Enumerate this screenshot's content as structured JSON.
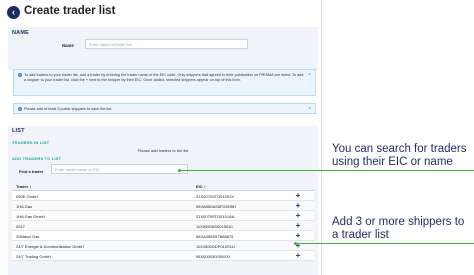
{
  "header": {
    "title": "Create trader list",
    "back_glyph": "‹"
  },
  "name_section": {
    "heading": "NAME",
    "name_label": "Name",
    "name_placeholder": "Enter name of trader list"
  },
  "info_boxes": [
    {
      "text": "To add traders to your trader list, add a trader by entering the trader name or the EIC code. Only shippers that agreed to their publication on PRISMA are listed. To add a shipper to your trader list, click the + next to the shipper by their EIC. Once added, selected shippers appear on top of this form."
    },
    {
      "text": "Please add at least 3 public shippers to save the list."
    }
  ],
  "list_section": {
    "heading": "LIST",
    "traders_heading": "TRADERS IN LIST",
    "empty_message": "Please add traders to the list",
    "add_heading": "ADD TRADERS TO LIST",
    "find_label": "Find a trader",
    "find_placeholder": "Enter trader name or EIC",
    "col_trader": "Trader ↕",
    "col_eic": "EIC ↕",
    "add_glyph": "+",
    "rows": [
      {
        "name": "050E GmbH",
        "eic": "21X0070STO01001X"
      },
      {
        "name": "1HA Gas",
        "eic": "96XA050AS5FG0H5H"
      },
      {
        "name": "1HA Gas GmbH",
        "eic": "21X0070STO0101AA"
      },
      {
        "name": "2017",
        "eic": "11X0090AS0015010"
      },
      {
        "name": "20Maxcl Gas",
        "eic": "56XA055S57B68675"
      },
      {
        "name": "24/7 Energie & Kommunikation GmbH",
        "eic": "11X1500GDP010S1U"
      },
      {
        "name": "24/7 Trading GmbH",
        "eic": "98X000030000000"
      }
    ]
  },
  "callouts": [
    {
      "text": "You can search for traders using their EIC or name"
    },
    {
      "text": "Add 3 or more shippers to a trader list"
    }
  ],
  "colors": {
    "accent_green": "#3fae3a",
    "navy": "#1a2d5e",
    "teal": "#1ea39a",
    "info_bg": "#ebf4fa"
  }
}
